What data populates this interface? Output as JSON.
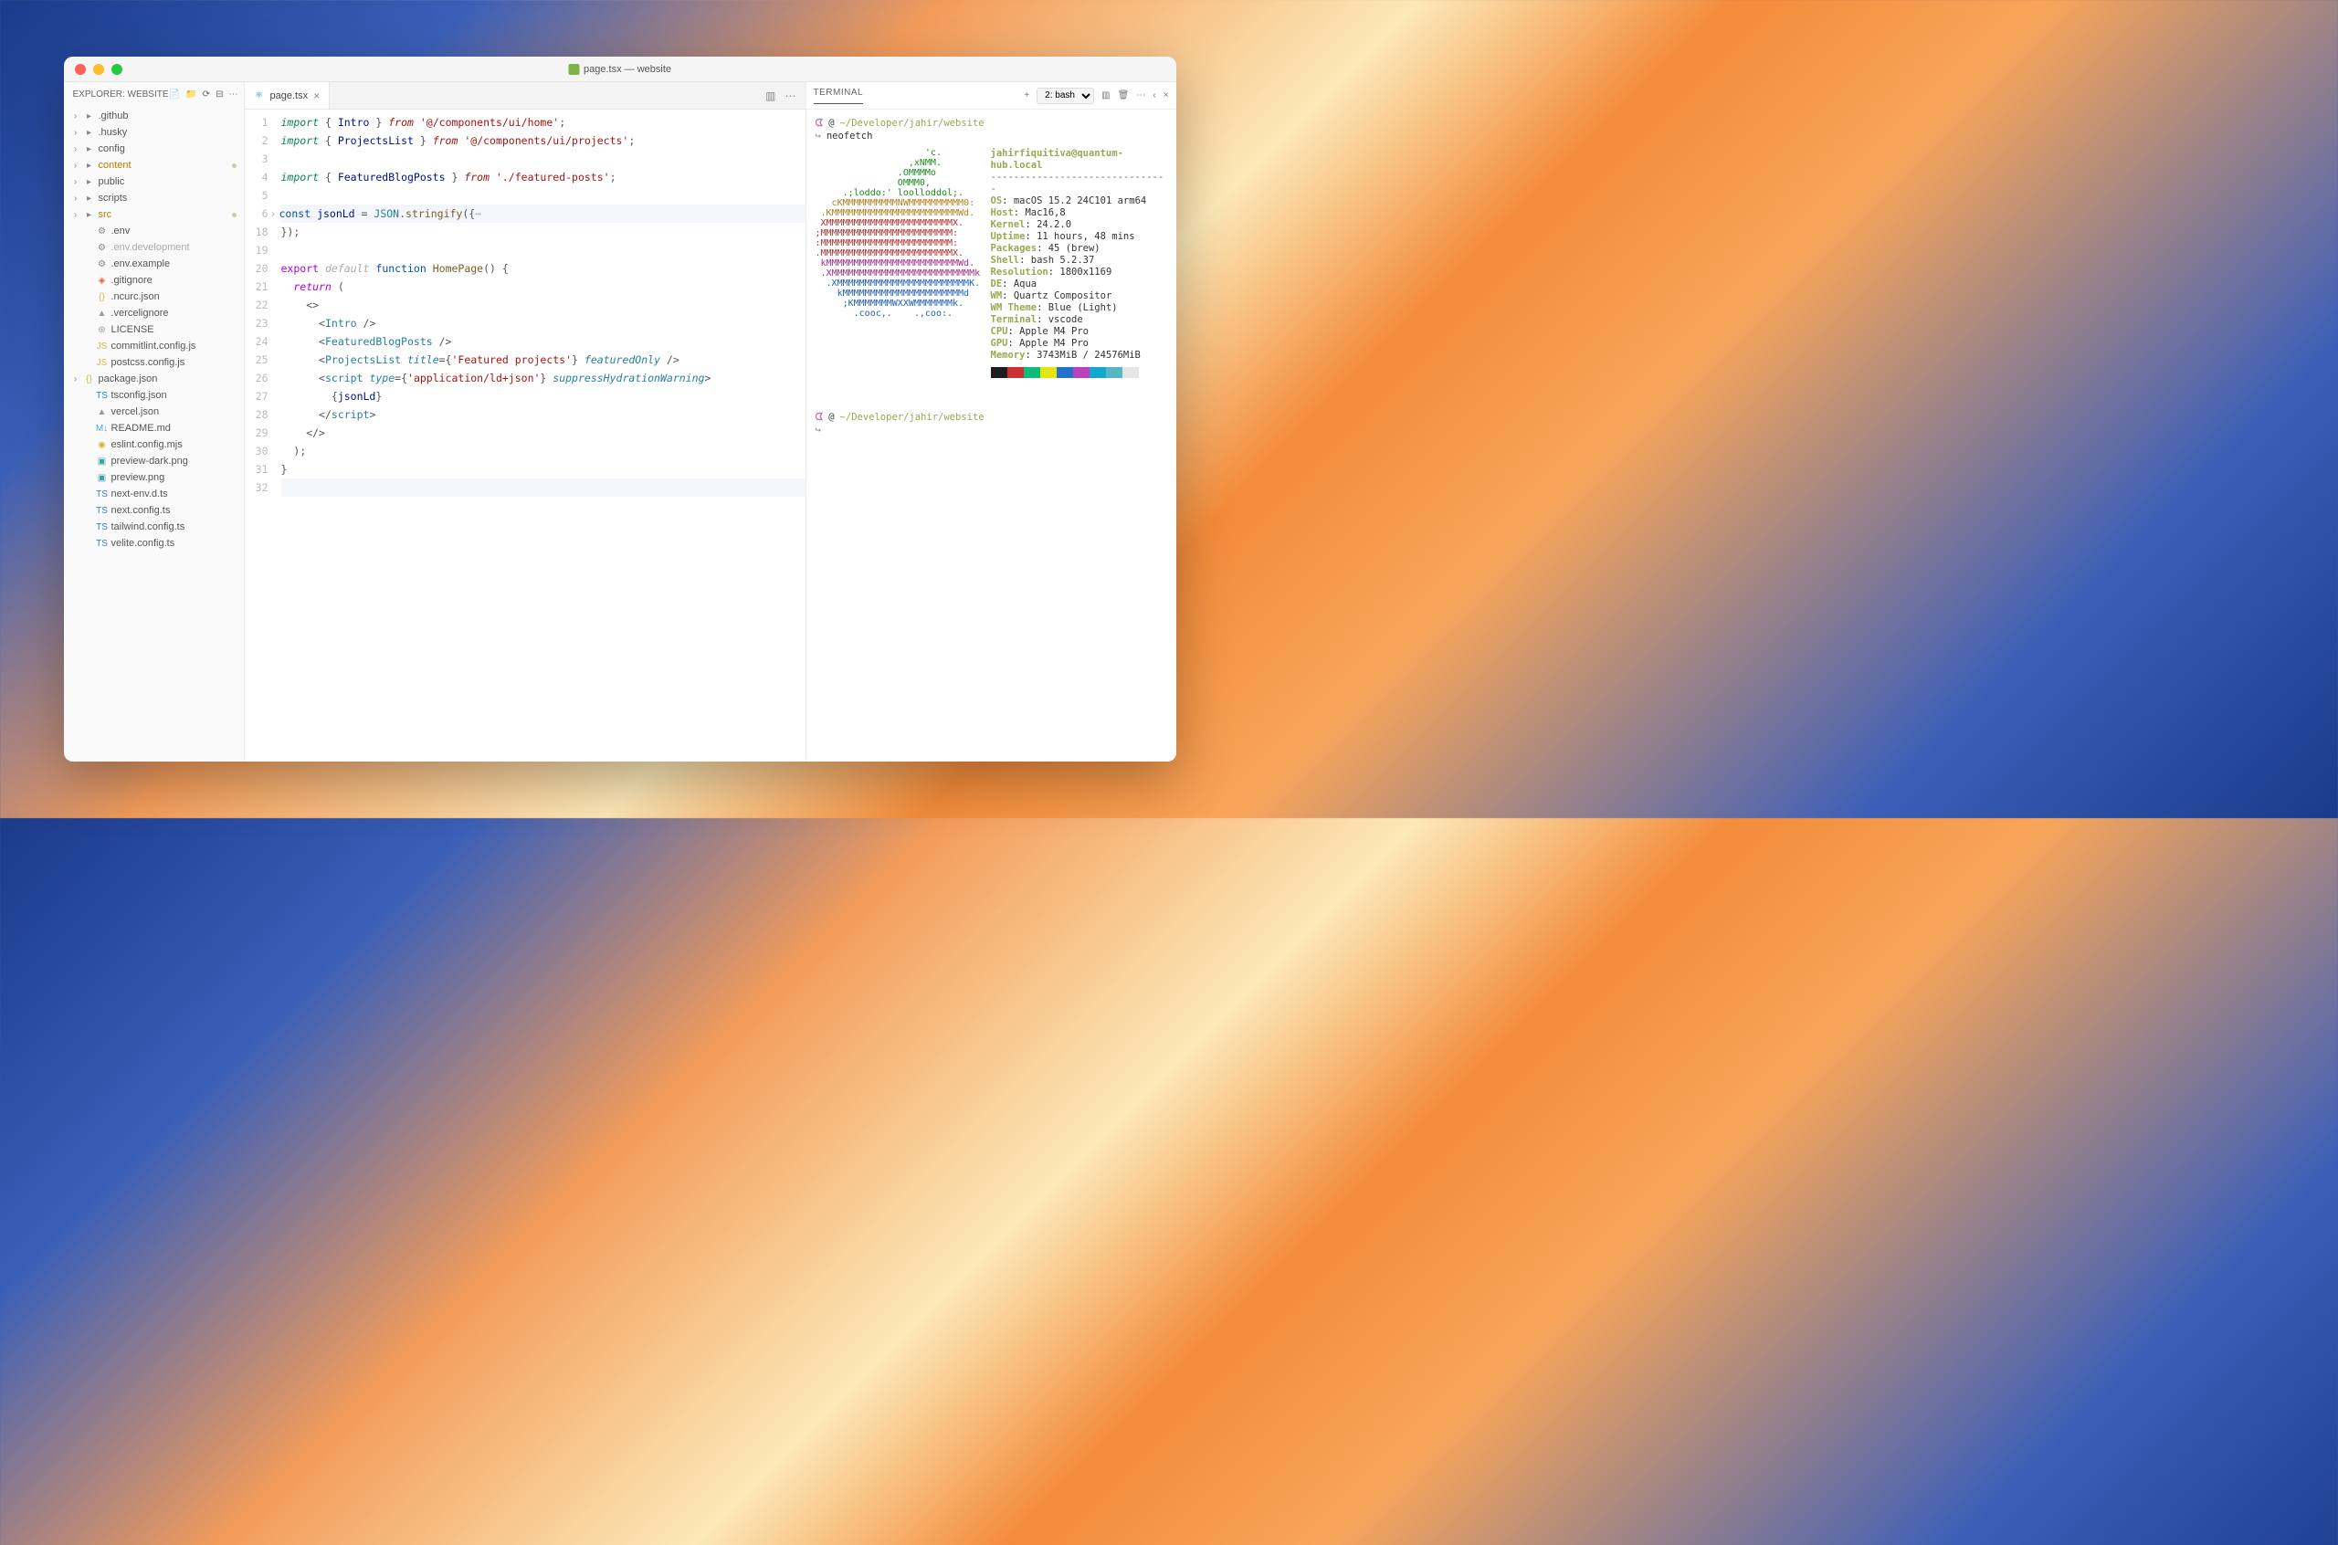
{
  "window": {
    "title": "page.tsx — website"
  },
  "explorer": {
    "header": "EXPLORER: WEBSITE",
    "items": [
      {
        "label": ".github",
        "lvl": 0,
        "chev": true,
        "icon": "folder",
        "cls": "ci-folder"
      },
      {
        "label": ".husky",
        "lvl": 0,
        "chev": true,
        "icon": "folder",
        "cls": "ci-folder"
      },
      {
        "label": "config",
        "lvl": 0,
        "chev": true,
        "icon": "folder",
        "cls": "ci-folder"
      },
      {
        "label": "content",
        "lvl": 0,
        "chev": true,
        "icon": "folder",
        "cls": "ci-folder",
        "modified": true,
        "dot": true
      },
      {
        "label": "public",
        "lvl": 0,
        "chev": true,
        "icon": "folder",
        "cls": "ci-folder"
      },
      {
        "label": "scripts",
        "lvl": 0,
        "chev": true,
        "icon": "folder",
        "cls": "ci-folder"
      },
      {
        "label": "src",
        "lvl": 0,
        "chev": true,
        "icon": "folder",
        "cls": "ci-folder",
        "modified": true,
        "dot": true
      },
      {
        "label": ".env",
        "lvl": 1,
        "icon": "gear",
        "cls": "ci-settings"
      },
      {
        "label": ".env.development",
        "lvl": 1,
        "icon": "gear",
        "cls": "ci-settings",
        "dim": true
      },
      {
        "label": ".env.example",
        "lvl": 1,
        "icon": "gear",
        "cls": "ci-settings"
      },
      {
        "label": ".gitignore",
        "lvl": 1,
        "icon": "git",
        "cls": "ci-git"
      },
      {
        "label": ".ncurc.json",
        "lvl": 1,
        "icon": "json",
        "cls": "ci-json"
      },
      {
        "label": ".vercelignore",
        "lvl": 1,
        "icon": "vercel",
        "cls": "ci-txt"
      },
      {
        "label": "LICENSE",
        "lvl": 1,
        "icon": "cert",
        "cls": "ci-txt"
      },
      {
        "label": "commitlint.config.js",
        "lvl": 1,
        "icon": "js",
        "cls": "ci-js"
      },
      {
        "label": "postcss.config.js",
        "lvl": 1,
        "icon": "js",
        "cls": "ci-js"
      },
      {
        "label": "package.json",
        "lvl": 0,
        "chev": true,
        "icon": "json",
        "cls": "ci-json"
      },
      {
        "label": "tsconfig.json",
        "lvl": 1,
        "icon": "ts",
        "cls": "ci-ts"
      },
      {
        "label": "vercel.json",
        "lvl": 1,
        "icon": "vercel",
        "cls": "ci-txt"
      },
      {
        "label": "README.md",
        "lvl": 1,
        "icon": "md",
        "cls": "ci-readme"
      },
      {
        "label": "eslint.config.mjs",
        "lvl": 1,
        "icon": "eslint",
        "cls": "ci-js"
      },
      {
        "label": "preview-dark.png",
        "lvl": 1,
        "icon": "img",
        "cls": "ci-img"
      },
      {
        "label": "preview.png",
        "lvl": 1,
        "icon": "img",
        "cls": "ci-img"
      },
      {
        "label": "next-env.d.ts",
        "lvl": 1,
        "icon": "ts",
        "cls": "ci-ts"
      },
      {
        "label": "next.config.ts",
        "lvl": 1,
        "icon": "ts",
        "cls": "ci-ts"
      },
      {
        "label": "tailwind.config.ts",
        "lvl": 1,
        "icon": "ts",
        "cls": "ci-ts"
      },
      {
        "label": "velite.config.ts",
        "lvl": 1,
        "icon": "ts",
        "cls": "ci-ts"
      }
    ]
  },
  "tab": {
    "name": "page.tsx"
  },
  "code": {
    "lines": [
      {
        "n": 1,
        "segs": [
          [
            "k-import",
            "import"
          ],
          [
            "k-punct",
            " { "
          ],
          [
            "k-ident",
            "Intro"
          ],
          [
            "k-punct",
            " } "
          ],
          [
            "k-from",
            "from"
          ],
          [
            "k-punct",
            " "
          ],
          [
            "k-str",
            "'@/components/ui/home'"
          ],
          [
            "k-punct",
            ";"
          ]
        ]
      },
      {
        "n": 2,
        "segs": [
          [
            "k-import",
            "import"
          ],
          [
            "k-punct",
            " { "
          ],
          [
            "k-ident",
            "ProjectsList"
          ],
          [
            "k-punct",
            " } "
          ],
          [
            "k-from",
            "from"
          ],
          [
            "k-punct",
            " "
          ],
          [
            "k-str",
            "'@/components/ui/projects'"
          ],
          [
            "k-punct",
            ";"
          ]
        ]
      },
      {
        "n": 3,
        "segs": []
      },
      {
        "n": 4,
        "segs": [
          [
            "k-import",
            "import"
          ],
          [
            "k-punct",
            " { "
          ],
          [
            "k-ident",
            "FeaturedBlogPosts"
          ],
          [
            "k-punct",
            " } "
          ],
          [
            "k-from",
            "from"
          ],
          [
            "k-punct",
            " "
          ],
          [
            "k-str",
            "'./featured-posts'"
          ],
          [
            "k-punct",
            ";"
          ]
        ]
      },
      {
        "n": 5,
        "segs": []
      },
      {
        "n": 6,
        "hl": true,
        "fold": true,
        "segs": [
          [
            "k-const",
            "const"
          ],
          [
            "k-punct",
            " "
          ],
          [
            "k-ident",
            "jsonLd"
          ],
          [
            "k-punct",
            " = "
          ],
          [
            "k-name",
            "JSON"
          ],
          [
            "k-punct",
            "."
          ],
          [
            "k-func",
            "stringify"
          ],
          [
            "k-punct",
            "({"
          ],
          [
            "k-default",
            "⋯"
          ]
        ]
      },
      {
        "n": 18,
        "segs": [
          [
            "k-punct",
            "});"
          ]
        ]
      },
      {
        "n": 19,
        "segs": []
      },
      {
        "n": 20,
        "segs": [
          [
            "k-export",
            "export"
          ],
          [
            "k-punct",
            " "
          ],
          [
            "k-default",
            "default"
          ],
          [
            "k-punct",
            " "
          ],
          [
            "k-keyword",
            "function"
          ],
          [
            "k-punct",
            " "
          ],
          [
            "k-func",
            "HomePage"
          ],
          [
            "k-punct",
            "() {"
          ]
        ]
      },
      {
        "n": 21,
        "segs": [
          [
            "k-punct",
            "  "
          ],
          [
            "k-return",
            "return"
          ],
          [
            "k-punct",
            " ("
          ]
        ]
      },
      {
        "n": 22,
        "segs": [
          [
            "k-punct",
            "    <>"
          ]
        ]
      },
      {
        "n": 23,
        "segs": [
          [
            "k-punct",
            "      <"
          ],
          [
            "k-tag",
            "Intro"
          ],
          [
            "k-punct",
            " />"
          ]
        ]
      },
      {
        "n": 24,
        "segs": [
          [
            "k-punct",
            "      <"
          ],
          [
            "k-tag",
            "FeaturedBlogPosts"
          ],
          [
            "k-punct",
            " />"
          ]
        ]
      },
      {
        "n": 25,
        "segs": [
          [
            "k-punct",
            "      <"
          ],
          [
            "k-tag",
            "ProjectsList"
          ],
          [
            "k-punct",
            " "
          ],
          [
            "k-attr",
            "title"
          ],
          [
            "k-punct",
            "={"
          ],
          [
            "k-str",
            "'Featured projects'"
          ],
          [
            "k-punct",
            "} "
          ],
          [
            "k-attr",
            "featuredOnly"
          ],
          [
            "k-punct",
            " />"
          ]
        ]
      },
      {
        "n": 26,
        "segs": [
          [
            "k-punct",
            "      <"
          ],
          [
            "k-tag",
            "script"
          ],
          [
            "k-punct",
            " "
          ],
          [
            "k-attr",
            "type"
          ],
          [
            "k-punct",
            "={"
          ],
          [
            "k-str",
            "'application/ld+json'"
          ],
          [
            "k-punct",
            "} "
          ],
          [
            "k-attr",
            "suppressHydrationWarning"
          ],
          [
            "k-punct",
            ">"
          ]
        ]
      },
      {
        "n": 27,
        "segs": [
          [
            "k-punct",
            "        {"
          ],
          [
            "k-ident",
            "jsonLd"
          ],
          [
            "k-punct",
            "}"
          ]
        ]
      },
      {
        "n": 28,
        "segs": [
          [
            "k-punct",
            "      </"
          ],
          [
            "k-tag",
            "script"
          ],
          [
            "k-punct",
            ">"
          ]
        ]
      },
      {
        "n": 29,
        "segs": [
          [
            "k-punct",
            "    </>"
          ]
        ]
      },
      {
        "n": 30,
        "segs": [
          [
            "k-punct",
            "  );"
          ]
        ]
      },
      {
        "n": 31,
        "segs": [
          [
            "k-punct",
            "}"
          ]
        ]
      },
      {
        "n": 32,
        "hl": true,
        "segs": []
      }
    ]
  },
  "terminal": {
    "tab_label": "TERMINAL",
    "shell_selector": "2: bash",
    "prompt_path": "~/Developer/jahir/website",
    "command": "neofetch",
    "user": "jahirfiquitiva@quantum-hub.local",
    "dashes": "-------------------------------",
    "info": [
      [
        "OS",
        "macOS 15.2 24C101 arm64"
      ],
      [
        "Host",
        "Mac16,8"
      ],
      [
        "Kernel",
        "24.2.0"
      ],
      [
        "Uptime",
        "11 hours, 48 mins"
      ],
      [
        "Packages",
        "45 (brew)"
      ],
      [
        "Shell",
        "bash 5.2.37"
      ],
      [
        "Resolution",
        "1800x1169"
      ],
      [
        "DE",
        "Aqua"
      ],
      [
        "WM",
        "Quartz Compositor"
      ],
      [
        "WM Theme",
        "Blue (Light)"
      ],
      [
        "Terminal",
        "vscode"
      ],
      [
        "CPU",
        "Apple M4 Pro"
      ],
      [
        "GPU",
        "Apple M4 Pro"
      ],
      [
        "Memory",
        "3743MiB / 24576MiB"
      ]
    ],
    "art": [
      [
        "art-g",
        "                    'c."
      ],
      [
        "art-g",
        "                 ,xNMM."
      ],
      [
        "art-g",
        "               .OMMMMo"
      ],
      [
        "art-g",
        "               OMMM0,"
      ],
      [
        "art-g",
        "     .;loddo:' loolloddol;."
      ],
      [
        "art-y",
        "   cKMMMMMMMMMMNWMMMMMMMMMM0:"
      ],
      [
        "art-y",
        " .KMMMMMMMMMMMMMMMMMMMMMMMWd."
      ],
      [
        "art-r",
        " XMMMMMMMMMMMMMMMMMMMMMMMX."
      ],
      [
        "art-r",
        ";MMMMMMMMMMMMMMMMMMMMMMMM:"
      ],
      [
        "art-r",
        ":MMMMMMMMMMMMMMMMMMMMMMMM:"
      ],
      [
        "art-r",
        ".MMMMMMMMMMMMMMMMMMMMMMMMX."
      ],
      [
        "art-m",
        " kMMMMMMMMMMMMMMMMMMMMMMMMWd."
      ],
      [
        "art-m",
        " .XMMMMMMMMMMMMMMMMMMMMMMMMMMk"
      ],
      [
        "art-b",
        "  .XMMMMMMMMMMMMMMMMMMMMMMMMK."
      ],
      [
        "art-b",
        "    kMMMMMMMMMMMMMMMMMMMMMMd"
      ],
      [
        "art-b",
        "     ;KMMMMMMMWXXWMMMMMMMk."
      ],
      [
        "art-b",
        "       .cooc,.    .,coo:."
      ]
    ],
    "colors": [
      "#1e1e1e",
      "#cc3131",
      "#0dbc79",
      "#e5e510",
      "#2472c8",
      "#bc3fbc",
      "#11a8cd",
      "#56b6c2",
      "#e5e5e5",
      "#ffffff"
    ]
  }
}
